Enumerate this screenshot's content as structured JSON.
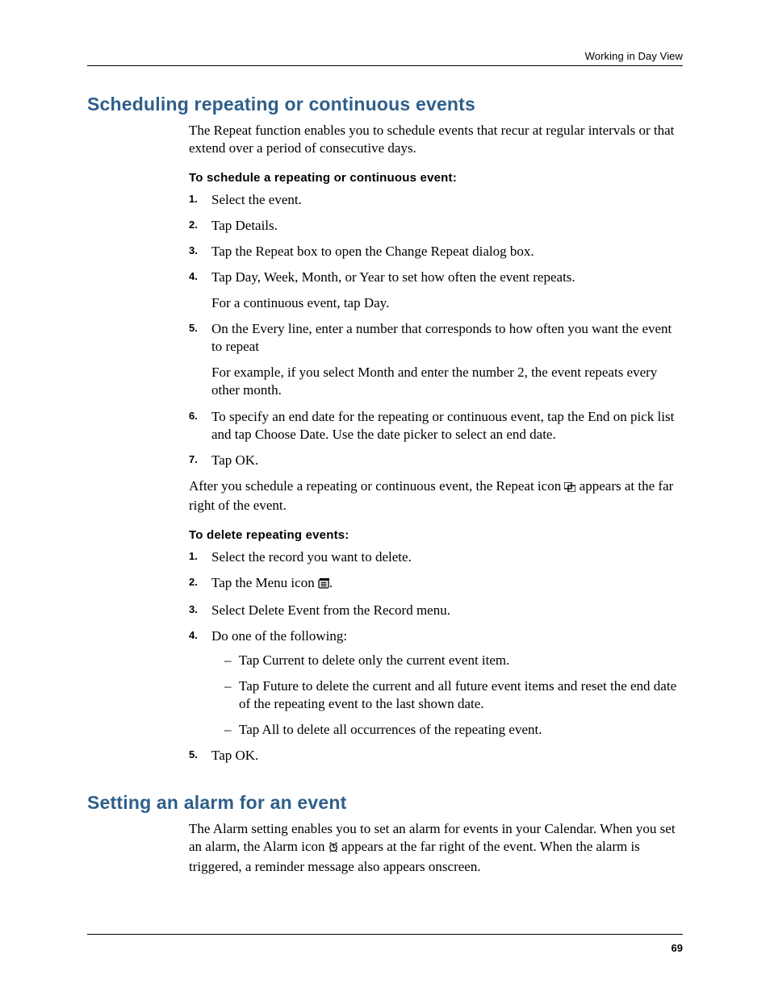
{
  "header": {
    "right": "Working in Day View"
  },
  "page_number": "69",
  "sec1": {
    "heading": "Scheduling repeating or continuous events",
    "intro": "The Repeat function enables you to schedule events that recur at regular intervals or that extend over a period of consecutive days.",
    "subhead1": "To schedule a repeating or continuous event:",
    "steps1": {
      "s1": "Select the event.",
      "s2": "Tap Details.",
      "s3": "Tap the Repeat box to open the Change Repeat dialog box.",
      "s4": "Tap Day, Week, Month, or Year to set how often the event repeats.",
      "s4_note": "For a continuous event, tap Day.",
      "s5": "On the Every line, enter a number that corresponds to how often you want the event to repeat",
      "s5_note": "For example, if you select Month and enter the number 2, the event repeats every other month.",
      "s6": "To specify an end date for the repeating or continuous event, tap the End on pick list and tap Choose Date. Use the date picker to select an end date.",
      "s7": "Tap OK."
    },
    "after_pre": "After you schedule a repeating or continuous event, the Repeat icon ",
    "after_post": " appears at the far right of the event.",
    "subhead2": "To delete repeating events:",
    "steps2": {
      "s1": "Select the record you want to delete.",
      "s2_pre": "Tap the Menu icon ",
      "s2_post": ".",
      "s3": "Select Delete Event from the Record menu.",
      "s4": "Do one of the following:",
      "s4_opts": {
        "a": "Tap Current to delete only the current event item.",
        "b": "Tap Future to delete the current and all future event items and reset the end date of the repeating event to the last shown date.",
        "c": "Tap All to delete all occurrences of the repeating event."
      },
      "s5": "Tap OK."
    }
  },
  "sec2": {
    "heading": "Setting an alarm for an event",
    "para_pre": "The Alarm setting enables you to set an alarm for events in your Calendar. When you set an alarm, the Alarm icon ",
    "para_post": " appears at the far right of the event. When the alarm is triggered, a reminder message also appears onscreen."
  }
}
